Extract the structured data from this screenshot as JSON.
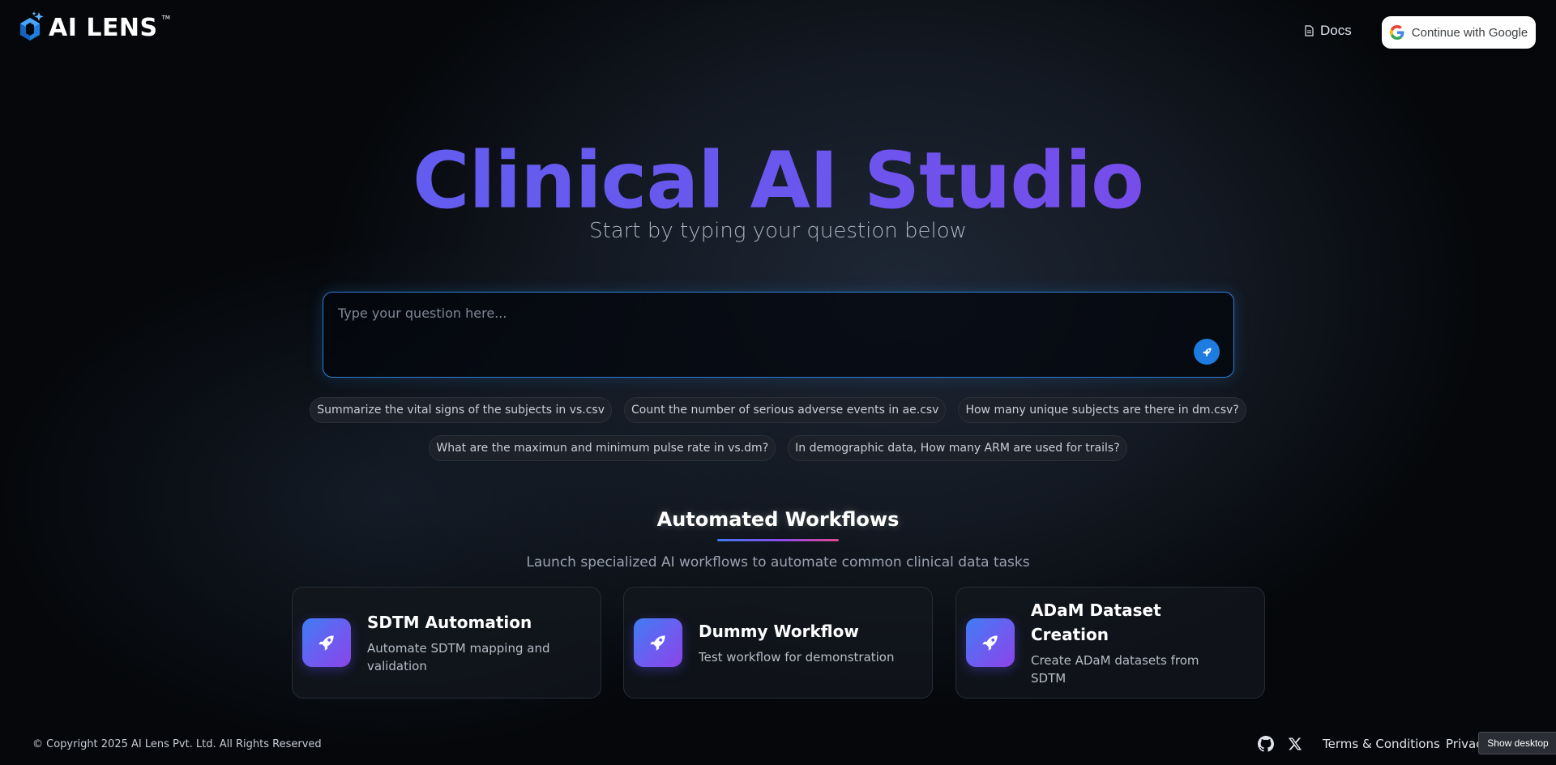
{
  "header": {
    "logo_text": "AI LENS",
    "logo_tm": "TM",
    "docs_label": "Docs",
    "google_button_label": "Continue with Google"
  },
  "hero": {
    "title": "Clinical AI Studio",
    "subtitle": "Start by typing your question below"
  },
  "question": {
    "placeholder": "Type your question here..."
  },
  "suggestions_row1": [
    "Summarize the vital signs of the subjects in vs.csv",
    "Count the number of serious adverse events in ae.csv",
    "How many unique subjects are there in dm.csv?"
  ],
  "suggestions_row2": [
    "What are the maximun and minimum pulse rate in vs.dm?",
    "In demographic data, How many ARM are used for trails?"
  ],
  "workflows": {
    "title": "Automated Workflows",
    "subtitle": "Launch specialized AI workflows to automate common clinical data tasks",
    "cards": [
      {
        "title": "SDTM Automation",
        "description": "Automate SDTM mapping and validation",
        "icon": "rocket-icon"
      },
      {
        "title": "Dummy Workflow",
        "description": "Test workflow for demonstration",
        "icon": "rocket-icon"
      },
      {
        "title": "ADaM Dataset Creation",
        "description": "Create ADaM datasets from SDTM",
        "icon": "rocket-icon"
      }
    ]
  },
  "footer": {
    "copyright": "© Copyright 2025 AI Lens Pvt. Ltd. All Rights Reserved",
    "terms": "Terms & Conditions",
    "privacy": "Privac",
    "show_desktop": "Show desktop"
  },
  "colors": {
    "accent_blue": "#2b7fd6",
    "title_gradient_start": "#5a63f1",
    "title_gradient_end": "#8440e6"
  }
}
